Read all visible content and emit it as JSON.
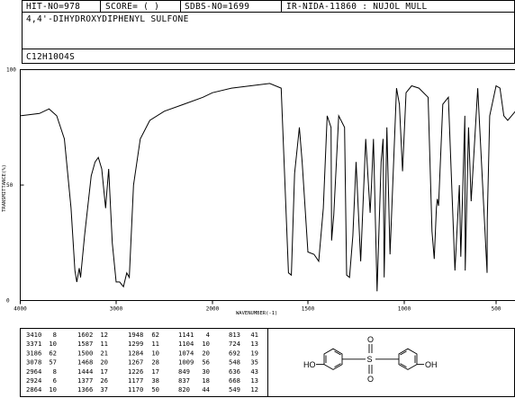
{
  "header": {
    "hit_no": "HIT-NO=978",
    "score": "SCORE= (  )",
    "sdbs_no": "SDBS-NO=1699",
    "ir_id": "IR-NIDA-11860 : NUJOL MULL",
    "compound": "4,4'-DIHYDROXYDIPHENYL SULFONE",
    "formula": "C12H10O4S"
  },
  "chart_data": {
    "type": "line",
    "xlabel": "WAVENUMBER(-1)",
    "ylabel": "TRANSMITTANCE(%)",
    "xlim": [
      4000,
      400
    ],
    "ylim": [
      0,
      100
    ],
    "x_ticks": [
      "4000",
      "3000",
      "2000",
      "1500",
      "1000",
      "500"
    ],
    "y_ticks": [
      "100",
      "50",
      "0"
    ],
    "colors": {
      "line": "#000000",
      "frame": "#000000"
    },
    "spectrum": [
      [
        4000,
        80
      ],
      [
        3800,
        81
      ],
      [
        3700,
        83
      ],
      [
        3620,
        80
      ],
      [
        3540,
        70
      ],
      [
        3470,
        40
      ],
      [
        3430,
        13
      ],
      [
        3410,
        8
      ],
      [
        3385,
        14
      ],
      [
        3371,
        10
      ],
      [
        3330,
        28
      ],
      [
        3260,
        54
      ],
      [
        3220,
        60
      ],
      [
        3186,
        62
      ],
      [
        3150,
        57
      ],
      [
        3110,
        40
      ],
      [
        3078,
        57
      ],
      [
        3040,
        25
      ],
      [
        3000,
        8
      ],
      [
        2964,
        8
      ],
      [
        2924,
        6
      ],
      [
        2890,
        12
      ],
      [
        2864,
        10
      ],
      [
        2820,
        50
      ],
      [
        2750,
        70
      ],
      [
        2650,
        78
      ],
      [
        2500,
        82
      ],
      [
        2300,
        85
      ],
      [
        2100,
        88
      ],
      [
        2000,
        90
      ],
      [
        1900,
        92
      ],
      [
        1800,
        93
      ],
      [
        1700,
        94
      ],
      [
        1640,
        92
      ],
      [
        1602,
        12
      ],
      [
        1587,
        11
      ],
      [
        1570,
        55
      ],
      [
        1545,
        75
      ],
      [
        1530,
        60
      ],
      [
        1500,
        21
      ],
      [
        1468,
        20
      ],
      [
        1444,
        17
      ],
      [
        1420,
        40
      ],
      [
        1400,
        80
      ],
      [
        1380,
        75
      ],
      [
        1377,
        26
      ],
      [
        1366,
        37
      ],
      [
        1340,
        80
      ],
      [
        1310,
        75
      ],
      [
        1299,
        11
      ],
      [
        1284,
        10
      ],
      [
        1267,
        28
      ],
      [
        1250,
        60
      ],
      [
        1226,
        17
      ],
      [
        1200,
        70
      ],
      [
        1177,
        38
      ],
      [
        1170,
        50
      ],
      [
        1160,
        70
      ],
      [
        1141,
        4
      ],
      [
        1120,
        60
      ],
      [
        1110,
        70
      ],
      [
        1104,
        10
      ],
      [
        1090,
        75
      ],
      [
        1074,
        20
      ],
      [
        1040,
        92
      ],
      [
        1025,
        85
      ],
      [
        1009,
        56
      ],
      [
        990,
        90
      ],
      [
        960,
        93
      ],
      [
        920,
        92
      ],
      [
        870,
        88
      ],
      [
        849,
        30
      ],
      [
        837,
        18
      ],
      [
        825,
        40
      ],
      [
        820,
        44
      ],
      [
        813,
        41
      ],
      [
        790,
        85
      ],
      [
        760,
        88
      ],
      [
        724,
        13
      ],
      [
        700,
        50
      ],
      [
        692,
        19
      ],
      [
        670,
        80
      ],
      [
        668,
        13
      ],
      [
        650,
        75
      ],
      [
        636,
        43
      ],
      [
        600,
        92
      ],
      [
        549,
        12
      ],
      [
        548,
        35
      ],
      [
        535,
        80
      ],
      [
        500,
        93
      ],
      [
        480,
        92
      ],
      [
        460,
        80
      ],
      [
        440,
        78
      ],
      [
        420,
        80
      ],
      [
        400,
        82
      ]
    ],
    "peak_table": [
      [
        "3410",
        "8"
      ],
      [
        "3371",
        "10"
      ],
      [
        "3186",
        "62"
      ],
      [
        "3078",
        "57"
      ],
      [
        "2964",
        "8"
      ],
      [
        "2924",
        "6"
      ],
      [
        "2864",
        "10"
      ],
      [
        "1602",
        "12"
      ],
      [
        "1587",
        "11"
      ],
      [
        "1500",
        "21"
      ],
      [
        "1468",
        "20"
      ],
      [
        "1444",
        "17"
      ],
      [
        "1377",
        "26"
      ],
      [
        "1366",
        "37"
      ],
      [
        "1948",
        "62"
      ],
      [
        "1299",
        "11"
      ],
      [
        "1284",
        "10"
      ],
      [
        "1267",
        "28"
      ],
      [
        "1226",
        "17"
      ],
      [
        "1177",
        "38"
      ],
      [
        "1170",
        "50"
      ],
      [
        "1141",
        "4"
      ],
      [
        "1104",
        "10"
      ],
      [
        "1074",
        "20"
      ],
      [
        "1009",
        "56"
      ],
      [
        "849",
        "30"
      ],
      [
        "837",
        "18"
      ],
      [
        "820",
        "44"
      ],
      [
        "813",
        "41"
      ],
      [
        "724",
        "13"
      ],
      [
        "692",
        "19"
      ],
      [
        "548",
        "35"
      ],
      [
        "636",
        "43"
      ],
      [
        "668",
        "13"
      ],
      [
        "549",
        "12"
      ]
    ]
  },
  "structure": {
    "left_group": "HO",
    "right_group": "OH",
    "center_atom": "S",
    "top_atom": "O",
    "bottom_atom": "O"
  }
}
